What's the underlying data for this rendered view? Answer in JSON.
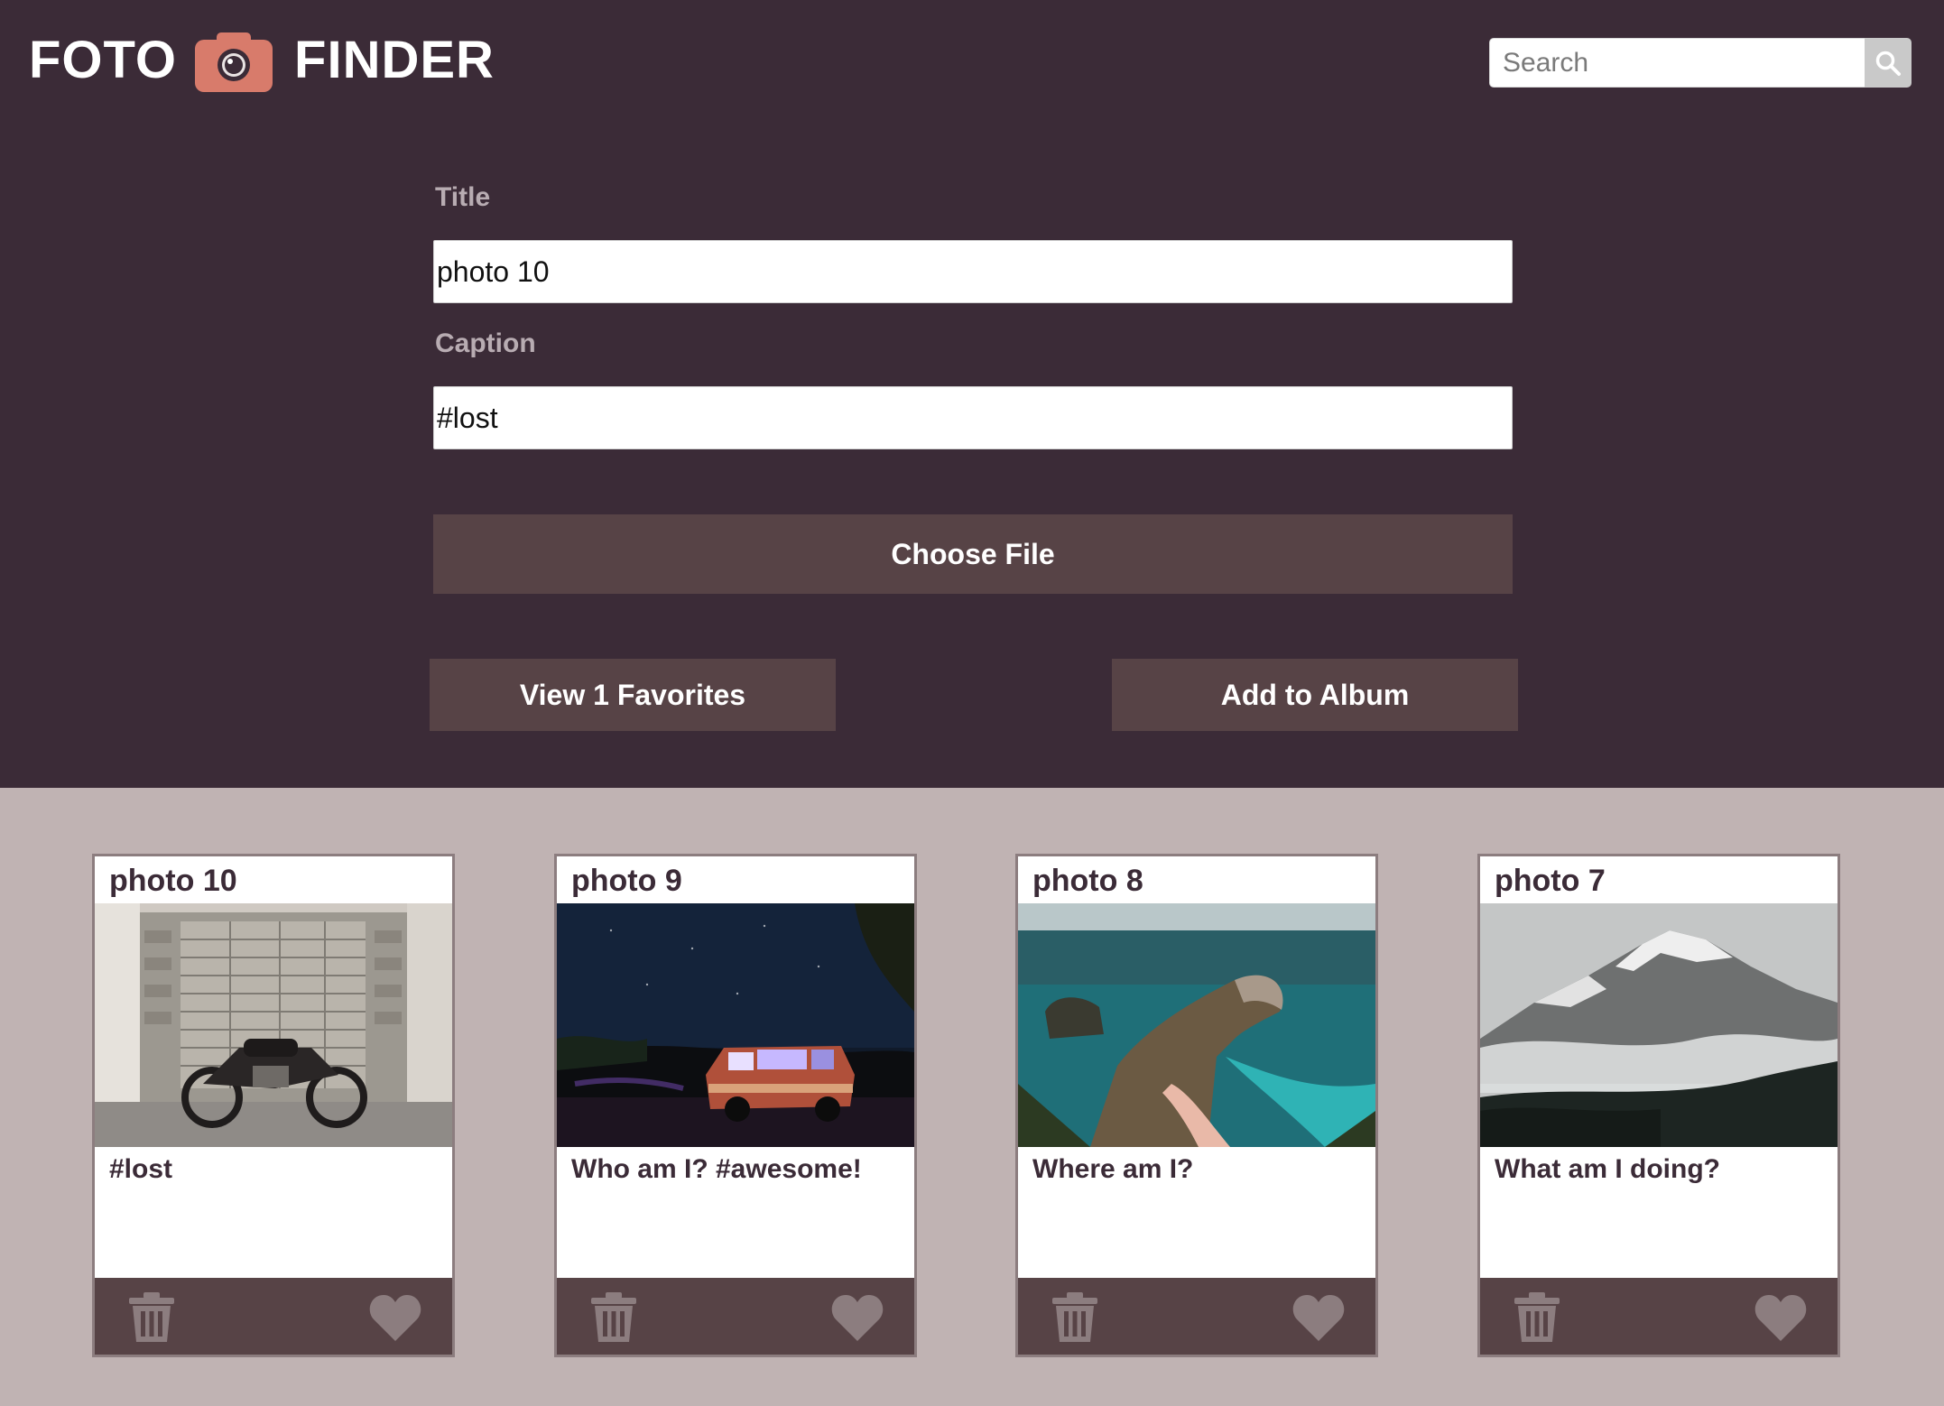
{
  "app": {
    "logo_left": "FOTO",
    "logo_right": "FINDER",
    "brand_color": "#d87b6b"
  },
  "search": {
    "placeholder": "Search",
    "icon": "search-icon"
  },
  "form": {
    "title_label": "Title",
    "title_value": "photo 10",
    "caption_label": "Caption",
    "caption_value": "#lost",
    "choose_file_label": "Choose File",
    "view_favorites_label": "View 1 Favorites",
    "add_to_album_label": "Add to Album"
  },
  "colors": {
    "header_bg": "#3b2b37",
    "button_bg": "#574346",
    "gallery_bg": "#c0b3b3"
  },
  "cards": [
    {
      "title": "photo 10",
      "caption": "#lost",
      "image": "motorcycle-photo",
      "favorited": false
    },
    {
      "title": "photo 9",
      "caption": "Who am I? #awesome!",
      "image": "van-at-night-photo",
      "favorited": false
    },
    {
      "title": "photo 8",
      "caption": "Where am I?",
      "image": "coastal-cliff-photo",
      "favorited": false
    },
    {
      "title": "photo 7",
      "caption": "What am I doing?",
      "image": "misty-mountains-photo",
      "favorited": false
    }
  ]
}
